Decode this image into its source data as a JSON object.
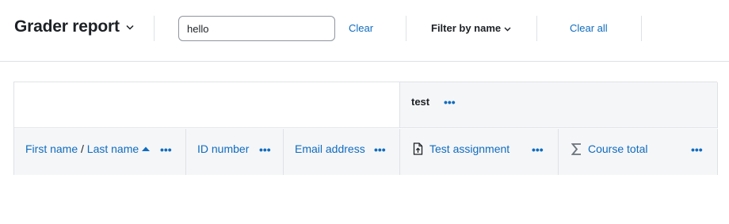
{
  "header": {
    "title": "Grader report",
    "search_value": "hello",
    "clear_label": "Clear",
    "filter_label": "Filter by name",
    "clear_all_label": "Clear all"
  },
  "table": {
    "category": {
      "label": "test",
      "menu": "•••"
    },
    "columns": [
      {
        "first_name": "First name",
        "separator": "/",
        "last_name": "Last name",
        "menu": "•••"
      },
      {
        "label": "ID number",
        "menu": "•••"
      },
      {
        "label": "Email address",
        "menu": "•••"
      },
      {
        "label": "Test assignment",
        "icon": "assignment-upload-icon",
        "menu": "•••"
      },
      {
        "label": "Course total",
        "icon": "sigma-icon",
        "menu": "•••"
      }
    ]
  },
  "colors": {
    "link": "#0f6cbf",
    "text": "#1d2125",
    "border": "#dee2e6",
    "header_bg": "#f5f6f8"
  }
}
